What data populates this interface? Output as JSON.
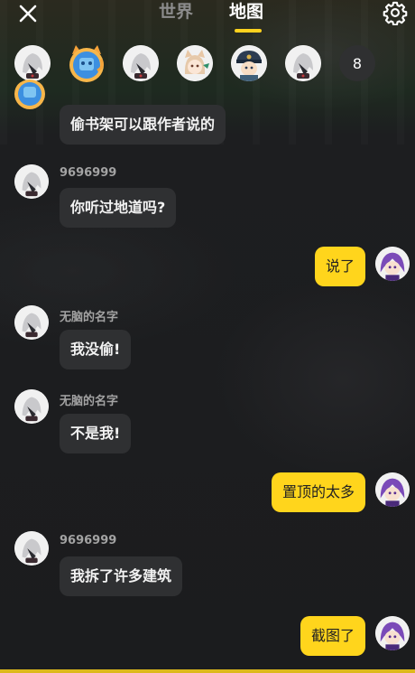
{
  "header": {
    "tabs": [
      {
        "label": "世界",
        "active": false
      },
      {
        "label": "地图",
        "active": true
      }
    ],
    "accent_color": "#ffd21e"
  },
  "members": {
    "overflow_count": "8"
  },
  "messages": [
    {
      "side": "in",
      "username": "",
      "text": "偷书架可以跟作者说的"
    },
    {
      "side": "in",
      "username": "9696999",
      "text": "你听过地道吗?"
    },
    {
      "side": "out",
      "username": "",
      "text": "说了"
    },
    {
      "side": "in",
      "username": "无脑的名字",
      "text": "我没偷!"
    },
    {
      "side": "in",
      "username": "无脑的名字",
      "text": "不是我!"
    },
    {
      "side": "out",
      "username": "",
      "text": "置顶的太多"
    },
    {
      "side": "in",
      "username": "9696999",
      "text": "我拆了许多建筑"
    },
    {
      "side": "out",
      "username": "",
      "text": "截图了"
    }
  ],
  "colors": {
    "bubble_in": "#2f3032",
    "bubble_out": "#ffd51c"
  }
}
